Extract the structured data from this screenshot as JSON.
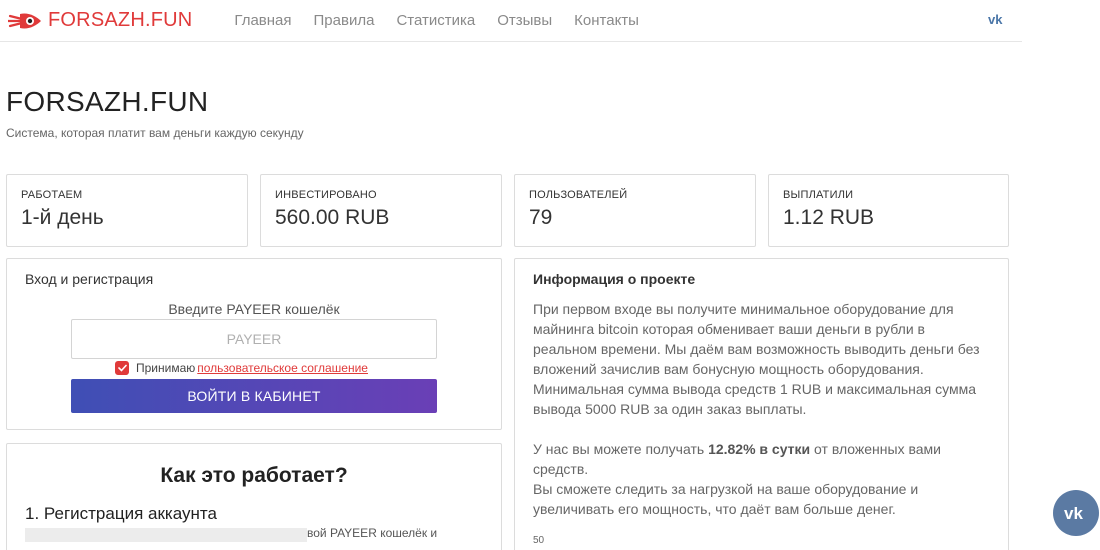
{
  "brand": {
    "name": "FORSAZH.FUN",
    "logo_icon": "rocket-logo-icon"
  },
  "nav": {
    "items": [
      {
        "label": "Главная"
      },
      {
        "label": "Правила"
      },
      {
        "label": "Статистика"
      },
      {
        "label": "Отзывы"
      },
      {
        "label": "Контакты"
      }
    ],
    "social_icon": "vk-icon"
  },
  "hero": {
    "title": "FORSAZH.FUN",
    "subtitle": "Система, которая платит вам деньги каждую секунду"
  },
  "stats": [
    {
      "label": "РАБОТАЕМ",
      "value": "1-й день"
    },
    {
      "label": "ИНВЕСТИРОВАНО",
      "value": "560.00 RUB"
    },
    {
      "label": "ПОЛЬЗОВАТЕЛЕЙ",
      "value": "79"
    },
    {
      "label": "ВЫПЛАТИЛИ",
      "value": "1.12 RUB"
    }
  ],
  "login": {
    "title": "Вход и регистрация",
    "field_label": "Введите PAYEER кошелёк",
    "placeholder": "PAYEER",
    "agree_text": "Принимаю",
    "agree_link": "пользовательское соглашение",
    "agree_checked": true,
    "button": "ВОЙТИ В КАБИНЕТ"
  },
  "how_it_works": {
    "title": "Как это работает?",
    "step1_title": "1. Регистрация аккаунта",
    "step1_text_visible": "вой PAYEER кошелёк и"
  },
  "info": {
    "title": "Информация о проекте",
    "paragraph1": "При первом входе вы получите минимальное оборудование для майнинга bitcoin которая обменивает ваши деньги в рубли в реальном времени. Мы даём вам возможность выводить деньги без вложений зачислив вам бонусную мощность оборудования. Минимальная сумма вывода средств 1 RUB и максимальная сумма вывода 5000 RUB за один заказ выплаты.",
    "paragraph2_before": "У нас вы можете получать ",
    "paragraph2_bold": "12.82% в сутки",
    "paragraph2_after": " от вложенных вами средств.",
    "paragraph3": "Вы сможете следить за нагрузкой на ваше оборудование и увеличивать его мощность, что даёт вам больше денег.",
    "chart_tick": "50"
  },
  "colors": {
    "brand_red": "#e03a3a",
    "button_gradient_start": "#3f4fb5",
    "button_gradient_end": "#6a3fb6",
    "vk_float": "#5b7aa3",
    "vk_blue": "#4a76a8"
  }
}
